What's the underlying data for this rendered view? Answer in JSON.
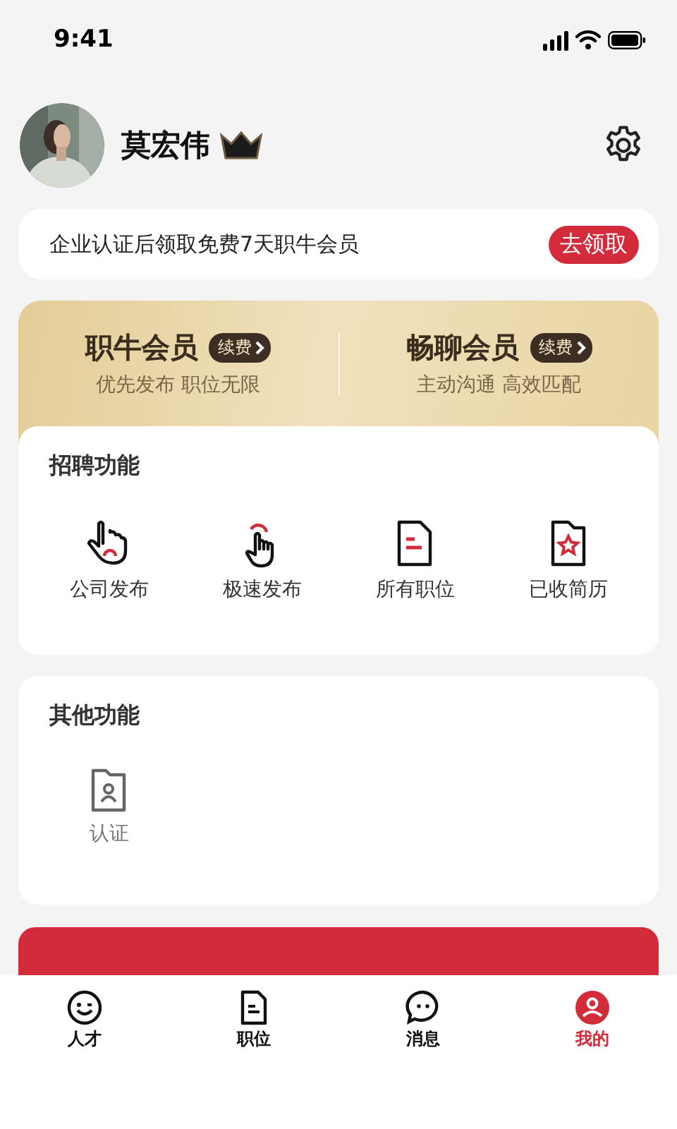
{
  "status_bar": {
    "time": "9:41"
  },
  "profile": {
    "name": "莫宏伟",
    "vip": true
  },
  "promo": {
    "text": "企业认证后领取免费7天职牛会员",
    "button": "去领取"
  },
  "memberships": [
    {
      "title": "职牛会员",
      "badge": "续费",
      "subtitle": "优先发布 职位无限"
    },
    {
      "title": "畅聊会员",
      "badge": "续费",
      "subtitle": "主动沟通 高效匹配"
    }
  ],
  "sections": [
    {
      "title": "招聘功能",
      "items": [
        {
          "label": "公司发布",
          "kind": "wave"
        },
        {
          "label": "极速发布",
          "kind": "tap"
        },
        {
          "label": "所有职位",
          "kind": "list"
        },
        {
          "label": "已收简历",
          "kind": "resume"
        }
      ]
    },
    {
      "title": "其他功能",
      "items": [
        {
          "label": "认证",
          "kind": "verify"
        }
      ]
    }
  ],
  "tabs": [
    {
      "label": "人才",
      "kind": "talent",
      "selected": false
    },
    {
      "label": "职位",
      "kind": "jobs",
      "selected": false
    },
    {
      "label": "消息",
      "kind": "messages",
      "selected": false
    },
    {
      "label": "我的",
      "kind": "me",
      "selected": true
    }
  ]
}
